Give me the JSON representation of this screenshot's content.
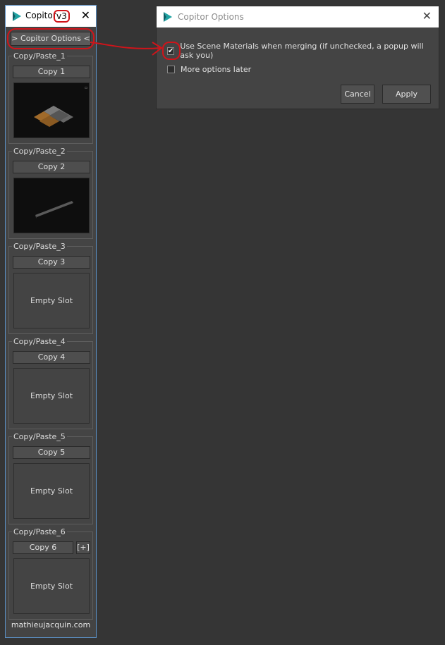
{
  "left_window": {
    "title": "Copitor",
    "version": "v3",
    "options_button": "> Copitor Options <",
    "slots": [
      {
        "label": "Copy/Paste_1",
        "button": "Copy 1",
        "state": "thumbnail"
      },
      {
        "label": "Copy/Paste_2",
        "button": "Copy 2",
        "state": "thumbnail"
      },
      {
        "label": "Copy/Paste_3",
        "button": "Copy 3",
        "state": "empty",
        "empty_text": "Empty Slot"
      },
      {
        "label": "Copy/Paste_4",
        "button": "Copy 4",
        "state": "empty",
        "empty_text": "Empty Slot"
      },
      {
        "label": "Copy/Paste_5",
        "button": "Copy 5",
        "state": "empty",
        "empty_text": "Empty Slot"
      },
      {
        "label": "Copy/Paste_6",
        "button": "Copy 6",
        "state": "empty",
        "empty_text": "Empty Slot",
        "extra_button": "[+]"
      }
    ],
    "footer": "mathieujacquin.com"
  },
  "options_dialog": {
    "title": "Copitor Options",
    "options": [
      {
        "label": "Use Scene Materials when merging (if unchecked, a popup will ask you)",
        "checked": true
      },
      {
        "label": "More options later",
        "checked": false
      }
    ],
    "cancel_label": "Cancel",
    "apply_label": "Apply"
  },
  "colors": {
    "background": "#353535",
    "panel": "#444444",
    "annotation": "#d0141a",
    "accent_border": "#5b8fc4",
    "icon_teal": "#1fa3a3"
  }
}
